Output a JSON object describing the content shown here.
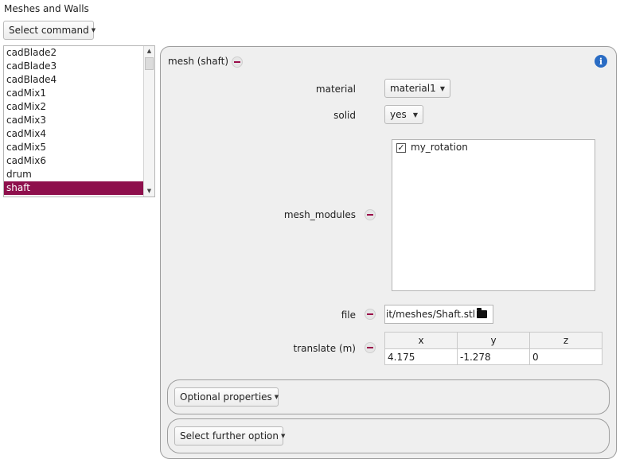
{
  "section_title": "Meshes and Walls",
  "select_command": "Select command",
  "mesh_list": [
    "cadBlade2",
    "cadBlade3",
    "cadBlade4",
    "cadMix1",
    "cadMix2",
    "cadMix3",
    "cadMix4",
    "cadMix5",
    "cadMix6",
    "drum",
    "shaft"
  ],
  "selected_mesh": "shaft",
  "panel": {
    "title": "mesh (shaft)",
    "material_label": "material",
    "material_value": "material1",
    "solid_label": "solid",
    "solid_value": "yes",
    "mesh_modules_label": "mesh_modules",
    "mesh_modules": [
      {
        "label": "my_rotation",
        "checked": true
      }
    ],
    "file_label": "file",
    "file_value": "it/meshes/Shaft.stl",
    "translate_label": "translate (m)",
    "translate_headers": [
      "x",
      "y",
      "z"
    ],
    "translate_values": [
      "4.175",
      "-1.278",
      "0"
    ],
    "optional_properties": "Optional properties",
    "select_further_option": "Select further option"
  },
  "colors": {
    "accent": "#8e0f4c",
    "info": "#2a6cc4"
  }
}
